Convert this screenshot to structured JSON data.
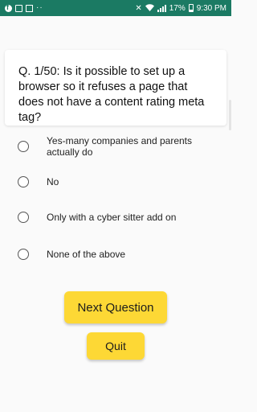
{
  "status_bar": {
    "left_icons": [
      "facebook-icon",
      "image-icon",
      "gmail-icon",
      "more-dots-icon"
    ],
    "dots": "··",
    "mute_symbol": "✕",
    "battery_percent": "17%",
    "time": "9:30 PM",
    "background_color": "#1b7a63"
  },
  "question": {
    "text": "Q. 1/50:  Is it possible to set up a browser so it refuses a page that does not have a content rating meta tag?"
  },
  "options": [
    {
      "label": "Yes-many companies and parents actually do"
    },
    {
      "label": "No"
    },
    {
      "label": "Only with a cyber sitter add on"
    },
    {
      "label": "None of the above"
    }
  ],
  "buttons": {
    "next_label": "Next Question",
    "quit_label": "Quit",
    "accent_color": "#fdd835"
  }
}
